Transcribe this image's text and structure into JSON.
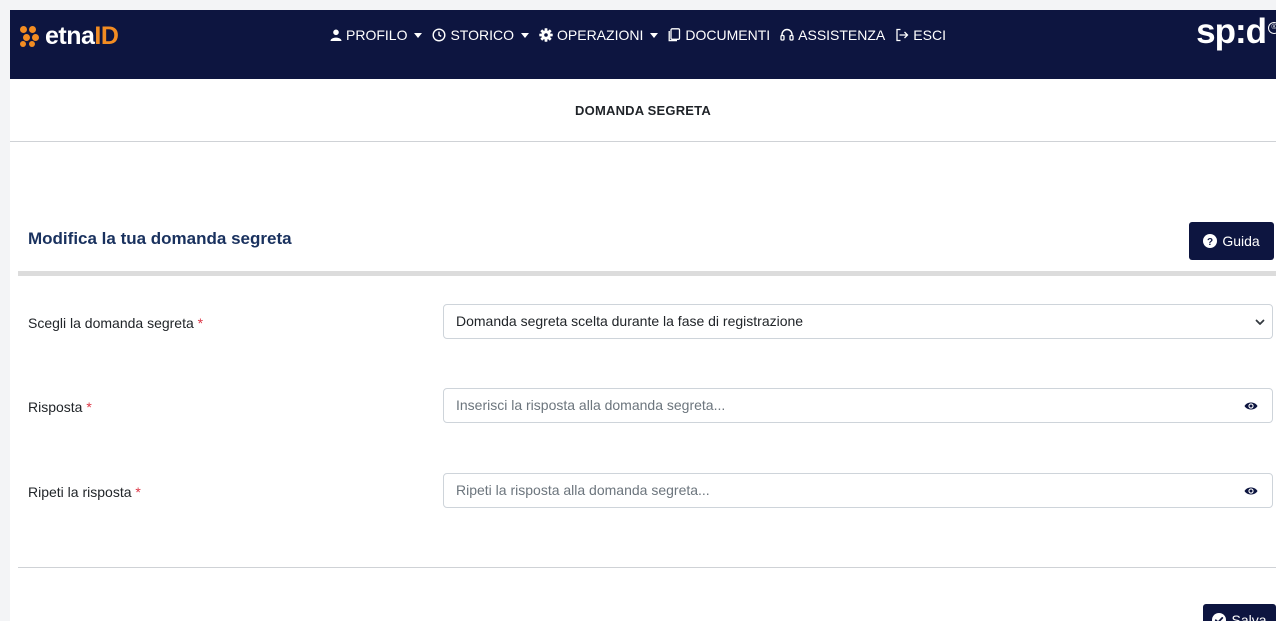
{
  "brand": {
    "logo_prefix": "etna",
    "logo_suffix": "ID",
    "spid_text": "sp:d",
    "spid_reg": "®",
    "accent": "#f28c22",
    "navbar_bg": "#0d1540"
  },
  "nav": {
    "items": [
      {
        "label": "PROFILO",
        "icon": "user-icon",
        "dropdown": true
      },
      {
        "label": "STORICO",
        "icon": "clock-icon",
        "dropdown": true
      },
      {
        "label": "OPERAZIONI",
        "icon": "gear-icon",
        "dropdown": true
      },
      {
        "label": "DOCUMENTI",
        "icon": "documents-icon",
        "dropdown": false
      },
      {
        "label": "ASSISTENZA",
        "icon": "headset-icon",
        "dropdown": false
      },
      {
        "label": "ESCI",
        "icon": "logout-icon",
        "dropdown": false
      }
    ]
  },
  "page": {
    "section_title": "DOMANDA SEGRETA"
  },
  "card": {
    "title": "Modifica la tua domanda segreta",
    "guide_label": "Guida",
    "required_mark": "*",
    "question_label": "Scegli la domanda segreta",
    "question_selected": "Domanda segreta scelta durante la fase di registrazione",
    "answer_label": "Risposta",
    "answer_placeholder": "Inserisci la risposta alla domanda segreta...",
    "repeat_label": "Ripeti la risposta",
    "repeat_placeholder": "Ripeti la risposta alla domanda segreta...",
    "save_label": "Salva"
  }
}
